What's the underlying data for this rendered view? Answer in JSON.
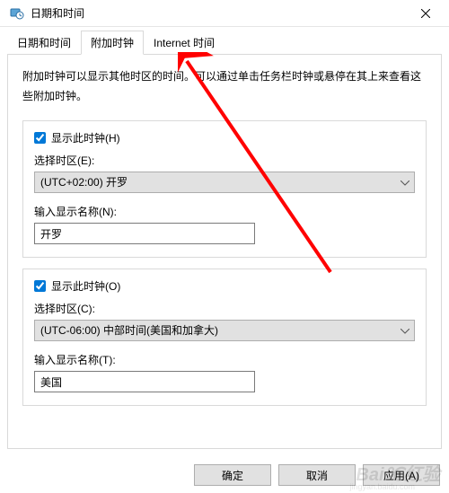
{
  "window": {
    "title": "日期和时间"
  },
  "tabs": [
    {
      "label": "日期和时间"
    },
    {
      "label": "附加时钟"
    },
    {
      "label": "Internet 时间"
    }
  ],
  "description": "附加时钟可以显示其他时区的时间。可以通过单击任务栏时钟或悬停在其上来查看这些附加时钟。",
  "clock1": {
    "show_label": "显示此时钟(H)",
    "checked": true,
    "tz_label": "选择时区(E):",
    "tz_value": "(UTC+02:00) 开罗",
    "name_label": "输入显示名称(N):",
    "name_value": "开罗"
  },
  "clock2": {
    "show_label": "显示此时钟(O)",
    "checked": true,
    "tz_label": "选择时区(C):",
    "tz_value": "(UTC-06:00) 中部时间(美国和加拿大)",
    "name_label": "输入显示名称(T):",
    "name_value": "美国"
  },
  "buttons": {
    "ok": "确定",
    "cancel": "取消",
    "apply": "应用(A)"
  },
  "watermark": {
    "main": "Bai℃红验",
    "sub": "jingyan.baidu.com"
  }
}
